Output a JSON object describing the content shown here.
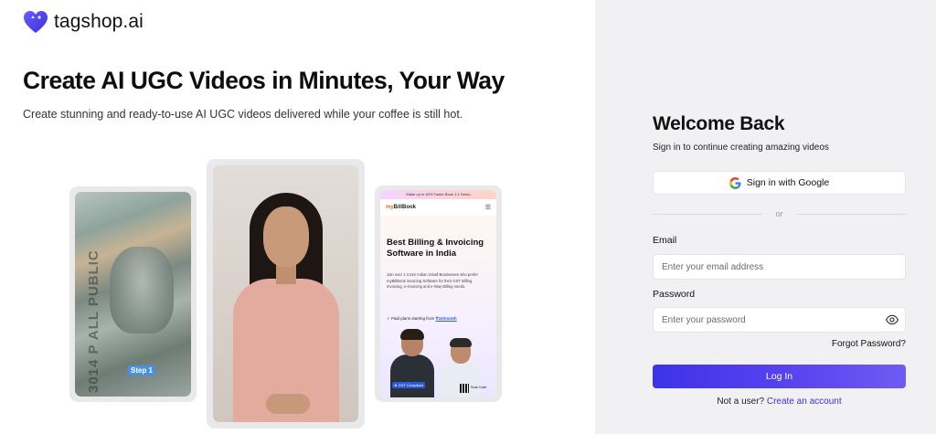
{
  "brand": {
    "name": "tagshop.ai",
    "accent": "#4b3cf0"
  },
  "hero": {
    "title": "Create AI UGC Videos in Minutes, Your Way",
    "subtitle": "Create stunning and ready-to-use AI UGC videos delivered while your coffee is still hot."
  },
  "previews": {
    "card1": {
      "step_label": "Step 1",
      "bill_text": "3014 P  ALL PUBLIC"
    },
    "card3": {
      "topbar": "Make up to 40% Faster  Book 1:1 Demo",
      "brand_prefix": "my",
      "brand_suffix": "BillBook",
      "headline": "Best Billing & Invoicing Software in India",
      "description": "Join over 1 Crore Indian Small Businesses who prefer myBillBook invoicing Software for their GST Billing, Invoicing, e-invoicing and e-Way Billing needs.",
      "plan_text": "✓ Paid plans starting from ",
      "plan_price": "₹10/month",
      "chip": "★ GST Compliant",
      "qr_label": "Scan Code"
    }
  },
  "auth": {
    "title": "Welcome Back",
    "subtitle": "Sign in to continue creating amazing videos",
    "google_label": "Sign in with Google",
    "divider": "or",
    "email_label": "Email",
    "email_placeholder": "Enter your email address",
    "email_value": "",
    "password_label": "Password",
    "password_placeholder": "Enter your password",
    "password_value": "",
    "forgot": "Forgot Password?",
    "login_label": "Log In",
    "signup_prompt": "Not a user?",
    "signup_link": "Create an account"
  },
  "icons": {
    "logo": "heart-logo-icon",
    "google": "google-icon",
    "password_toggle": "eye-icon"
  }
}
